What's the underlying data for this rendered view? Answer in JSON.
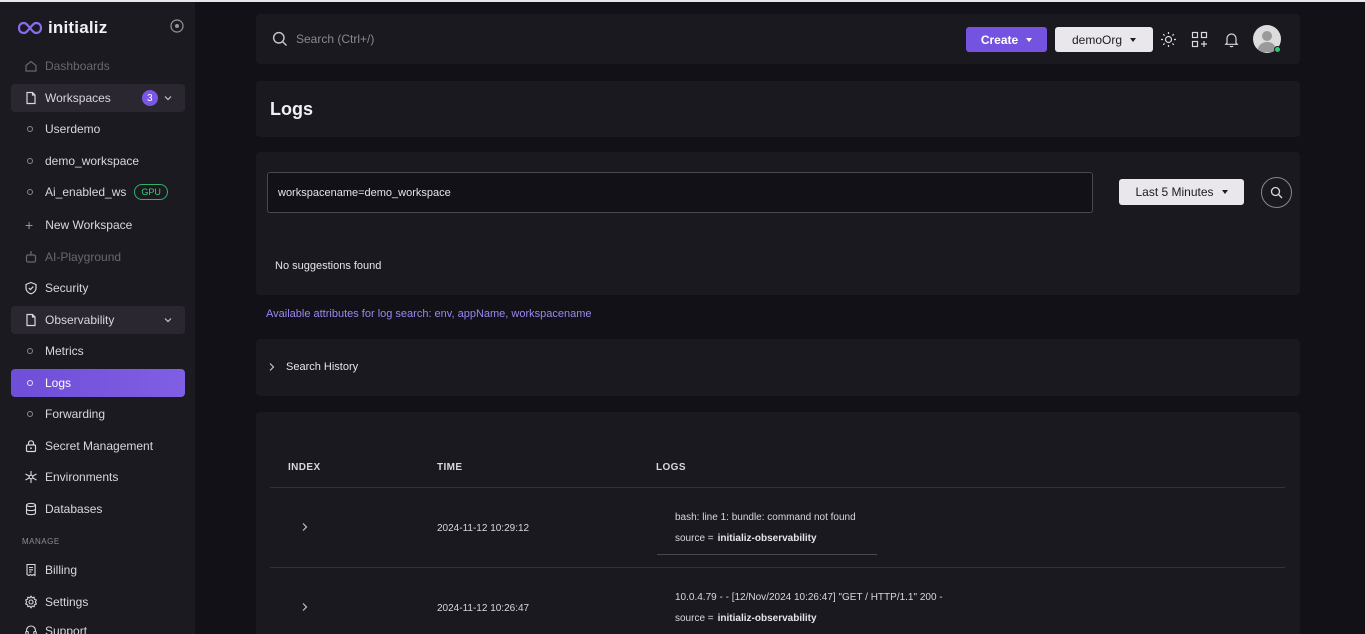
{
  "brand": {
    "name": "initializ"
  },
  "sidebar": {
    "items": [
      {
        "label": "Dashboards"
      },
      {
        "label": "Workspaces",
        "count": "3"
      },
      {
        "label": "Userdemo"
      },
      {
        "label": "demo_workspace"
      },
      {
        "label": "Ai_enabled_ws",
        "badge": "GPU"
      },
      {
        "label": "New Workspace"
      },
      {
        "label": "AI-Playground"
      },
      {
        "label": "Security"
      },
      {
        "label": "Observability"
      },
      {
        "label": "Metrics"
      },
      {
        "label": "Logs"
      },
      {
        "label": "Forwarding"
      },
      {
        "label": "Secret Management"
      },
      {
        "label": "Environments"
      },
      {
        "label": "Databases"
      },
      {
        "label": "Billing"
      },
      {
        "label": "Settings"
      },
      {
        "label": "Support"
      }
    ],
    "section_manage": "MANAGE"
  },
  "topbar": {
    "search_placeholder": "Search (Ctrl+/)",
    "create_label": "Create",
    "org_label": "demoOrg"
  },
  "page": {
    "title": "Logs"
  },
  "query": {
    "value": "workspacename=demo_workspace",
    "range_label": "Last 5 Minutes",
    "no_suggestions": "No suggestions found",
    "attributes_hint": "Available attributes for log search: env, appName, workspacename"
  },
  "history": {
    "label": "Search History"
  },
  "table": {
    "headers": {
      "index": "INDEX",
      "time": "TIME",
      "logs": "LOGS"
    },
    "rows": [
      {
        "time": "2024-11-12 10:29:12",
        "message": "bash: line 1: bundle: command not found",
        "source_label": "source =",
        "source_value": "initializ-observability"
      },
      {
        "time": "2024-11-12 10:26:47",
        "message": "10.0.4.79 - - [12/Nov/2024 10:26:47] \"GET / HTTP/1.1\" 200 -",
        "source_label": "source =",
        "source_value": "initializ-observability"
      }
    ]
  },
  "colors": {
    "accent": "#7453e0",
    "background": "#131118",
    "panel": "#1b1920",
    "online": "#2ecc71"
  }
}
